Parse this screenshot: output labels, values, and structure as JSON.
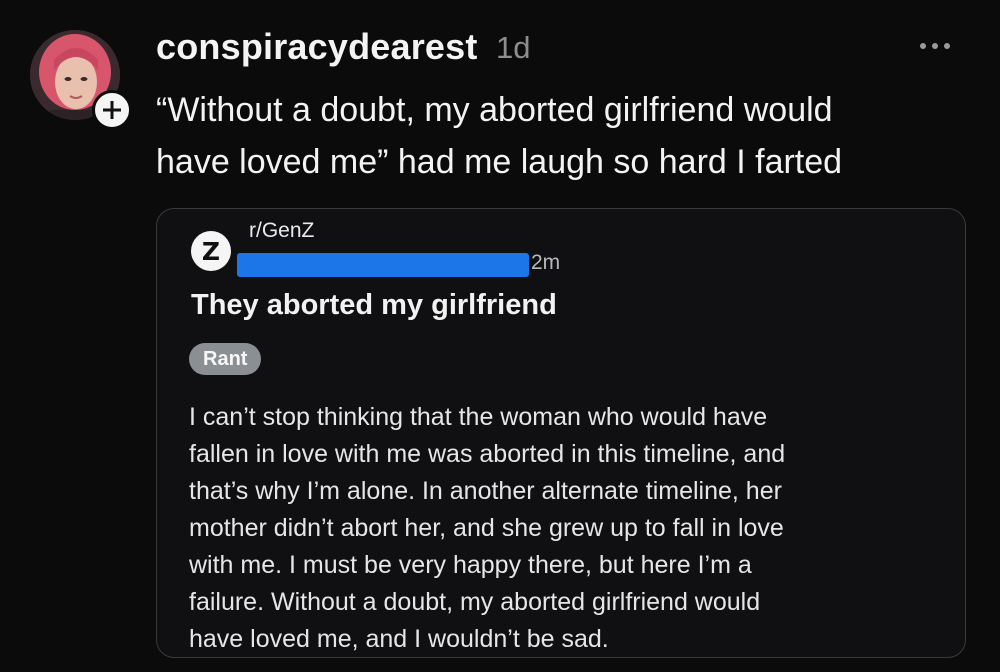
{
  "post": {
    "username": "conspiracydearest",
    "timestamp": "1d",
    "text_lines": [
      "“Without a doubt, my aborted girlfriend would",
      "have loved me”  had me laugh so hard I farted"
    ],
    "follow_icon": "plus-icon",
    "menu_icon": "more-icon"
  },
  "quote": {
    "subreddit_icon_letter": "Z",
    "subreddit": "r/GenZ",
    "time": "2m",
    "title": "They aborted my girlfriend",
    "flair": "Rant",
    "body_lines": [
      "I can’t stop thinking that the woman who would have",
      "fallen in love with me was aborted in this timeline, and",
      "that’s why I’m alone. In another alternate timeline, her",
      "mother didn’t abort her, and she grew up to fall in love",
      "with me. I must be very happy there, but here I’m a",
      "failure. Without a doubt, my aborted girlfriend would",
      "have loved me, and I wouldn’t be sad."
    ]
  },
  "colors": {
    "background": "#0b0b0c",
    "redaction": "#1d76e8",
    "flair_bg": "#8a8f94",
    "muted_text": "#8e8e8e"
  }
}
